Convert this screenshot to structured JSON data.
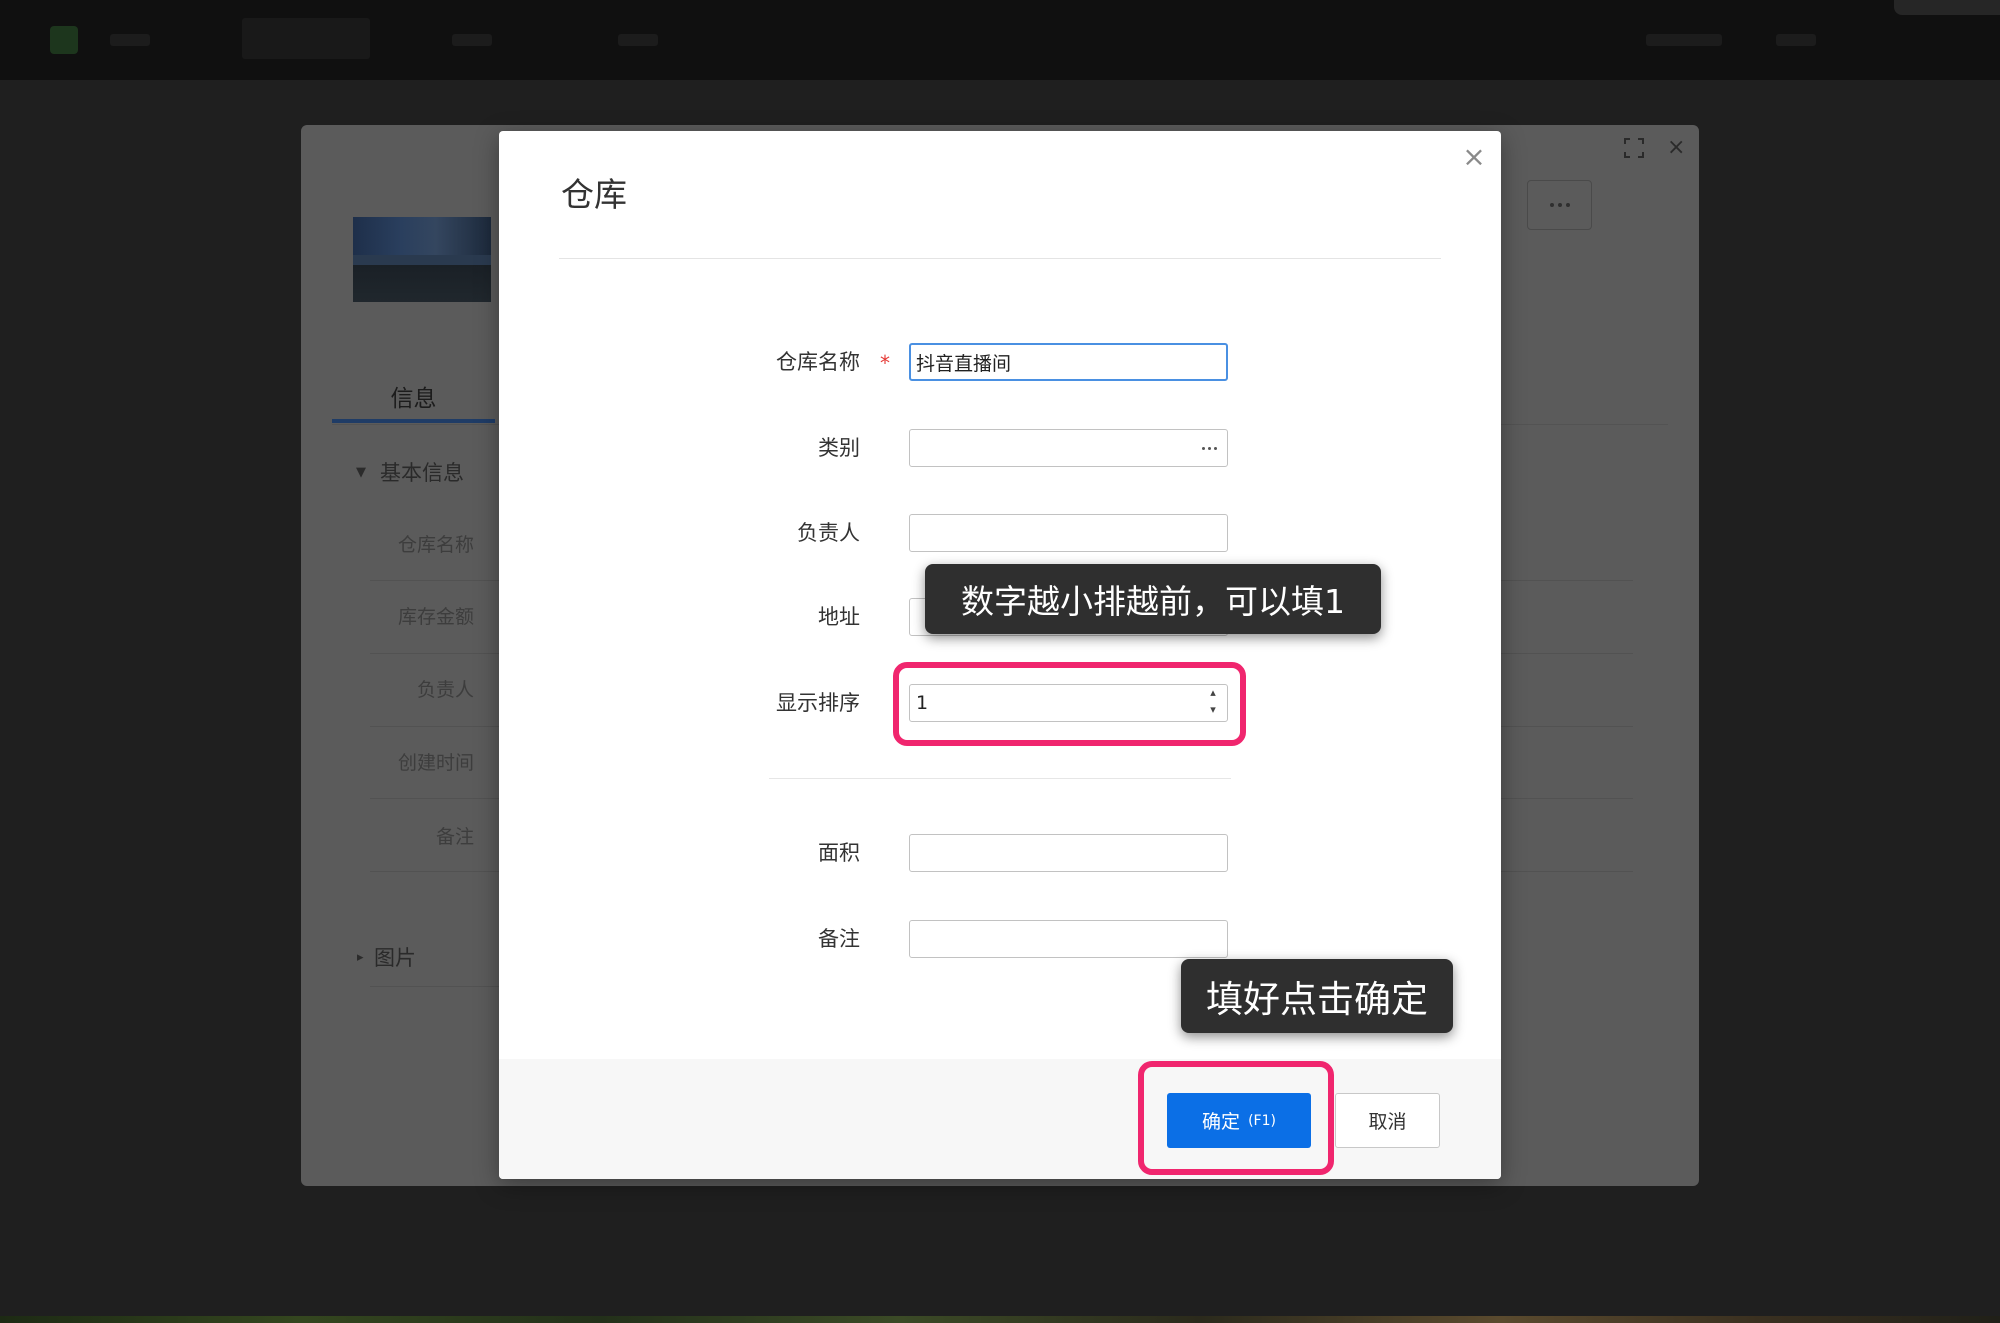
{
  "window": {
    "maximize_icon": "maximize-icon",
    "close_icon": "close-icon"
  },
  "background_panel": {
    "tab_info": "信息",
    "section_basic": {
      "label": "基本信息",
      "icon": "caret-down-icon"
    },
    "rows": [
      "仓库名称",
      "库存金额",
      "负责人",
      "创建时间",
      "备注"
    ],
    "section_images": {
      "label": "图片",
      "icon": "caret-right-icon"
    },
    "more_icon": "more-dots-icon"
  },
  "modal": {
    "title": "仓库",
    "close_icon": "close-icon",
    "required_mark": "*",
    "fields": [
      {
        "label": "仓库名称",
        "required": true,
        "value": "抖音直播间"
      },
      {
        "label": "类别",
        "value": "",
        "picker_icon": "ellipsis-icon"
      },
      {
        "label": "负责人",
        "value": ""
      },
      {
        "label": "地址",
        "value": ""
      },
      {
        "label": "显示排序",
        "value": "1",
        "spinner_icon": "spinner-arrows-icon"
      },
      {
        "label": "面积",
        "value": ""
      },
      {
        "label": "备注",
        "value": ""
      }
    ],
    "confirm": {
      "label": "确定",
      "shortcut": "(F1)"
    },
    "cancel": {
      "label": "取消"
    }
  },
  "annotations": {
    "sort_tip": "数字越小排越前，可以填1",
    "confirm_tip": "填好点击确定"
  },
  "colors": {
    "primary": "#0b6fe6",
    "highlight": "#f0266e",
    "required": "#e53935",
    "focus_border": "#4a90e2",
    "tooltip_bg": "#2f2f2f"
  }
}
